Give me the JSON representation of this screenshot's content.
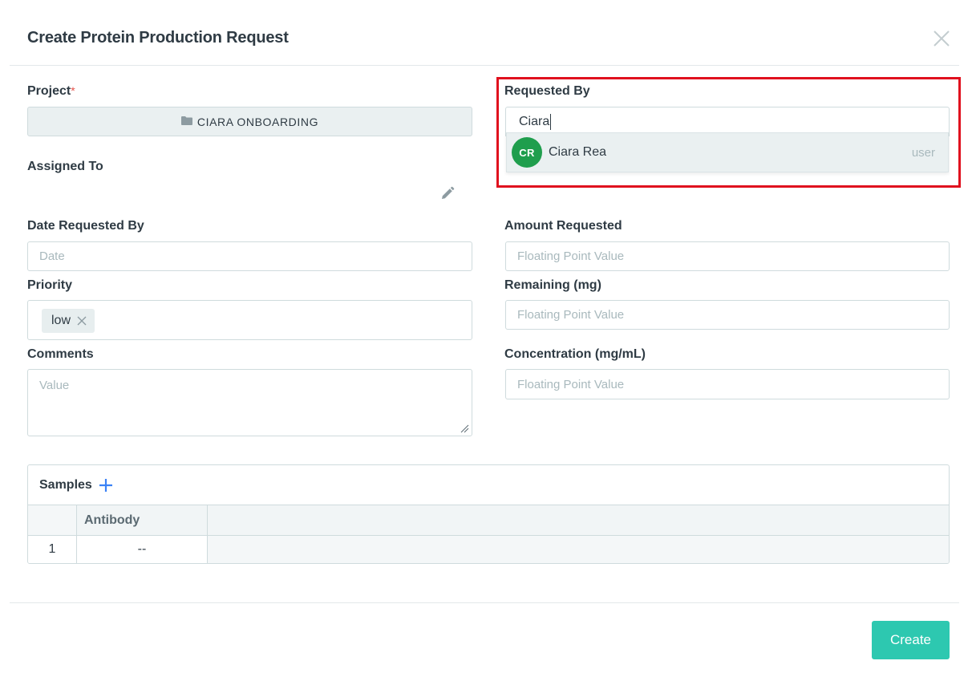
{
  "modal": {
    "title": "Create Protein Production Request",
    "create_label": "Create"
  },
  "fields": {
    "project": {
      "label": "Project",
      "required_mark": "*",
      "value": "CIARA ONBOARDING"
    },
    "assigned_to": {
      "label": "Assigned To"
    },
    "requested_by": {
      "label": "Requested By",
      "value": "Ciara"
    },
    "date_requested_by": {
      "label": "Date Requested By",
      "placeholder": "Date"
    },
    "amount_requested": {
      "label": "Amount Requested",
      "placeholder": "Floating Point Value"
    },
    "priority": {
      "label": "Priority",
      "tag": "low"
    },
    "remaining": {
      "label": "Remaining (mg)",
      "placeholder": "Floating Point Value"
    },
    "comments": {
      "label": "Comments",
      "placeholder": "Value"
    },
    "concentration": {
      "label": "Concentration (mg/mL)",
      "placeholder": "Floating Point Value"
    }
  },
  "dropdown": {
    "options": [
      {
        "initials": "CR",
        "name": "Ciara Rea",
        "type": "user",
        "avatar_color": "#1f9e4d"
      }
    ]
  },
  "samples": {
    "title": "Samples",
    "columns": [
      "",
      "Antibody"
    ],
    "rows": [
      {
        "index": "1",
        "antibody": "--"
      }
    ]
  },
  "colors": {
    "accent": "#2dc8b0",
    "highlight": "#e0101e",
    "plus": "#3b82f6",
    "required": "#e5534b"
  }
}
